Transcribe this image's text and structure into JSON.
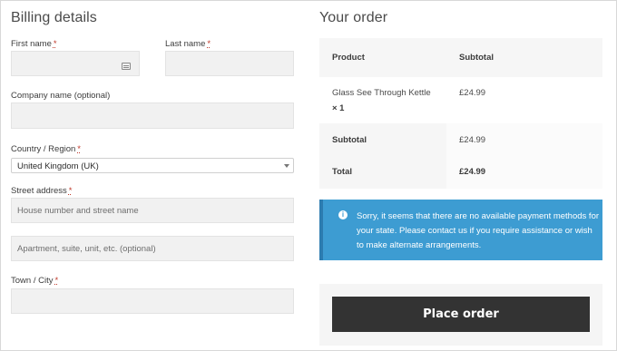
{
  "billing": {
    "heading": "Billing details",
    "required_mark": "*",
    "first_name_label": "First name",
    "last_name_label": "Last name",
    "company_label": "Company name (optional)",
    "country_label": "Country / Region",
    "country_value": "United Kingdom (UK)",
    "street_label": "Street address",
    "street_placeholder_1": "House number and street name",
    "street_placeholder_2": "Apartment, suite, unit, etc. (optional)",
    "city_label": "Town / City"
  },
  "order": {
    "heading": "Your order",
    "col_product": "Product",
    "col_subtotal": "Subtotal",
    "item_name": "Glass See Through Kettle",
    "item_qty": "× 1",
    "item_price": "£24.99",
    "subtotal_label": "Subtotal",
    "subtotal_value": "£24.99",
    "total_label": "Total",
    "total_value": "£24.99",
    "notice_icon": "info-icon",
    "notice_text": "Sorry, it seems that there are no available payment methods for your state. Please contact us if you require assistance or wish to make alternate arrangements.",
    "place_order": "Place order"
  },
  "colors": {
    "notice_bg": "#3d9cd2",
    "button_bg": "#333333",
    "field_bg": "#f1f1f1",
    "required": "#c0392b"
  }
}
